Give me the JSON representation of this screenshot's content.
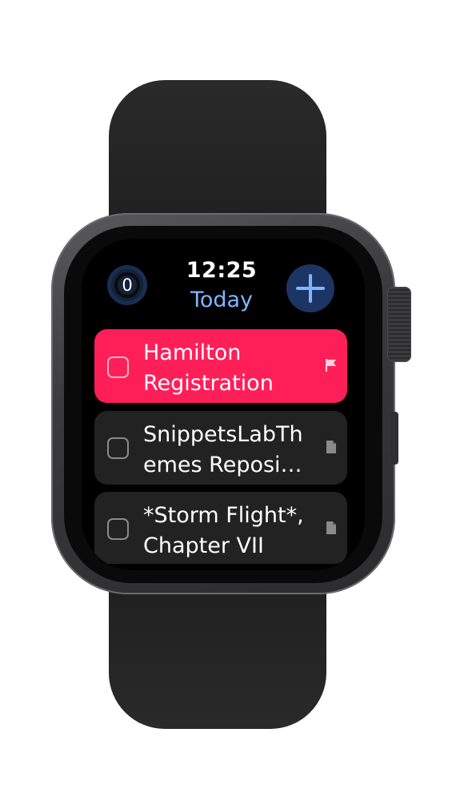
{
  "status": {
    "time": "12:25",
    "title": "Today"
  },
  "counter": {
    "value": "0"
  },
  "add": {
    "icon": "plus-icon"
  },
  "tasks": [
    {
      "title": "Hamilton\nRegistration",
      "flagged": true,
      "icon": "flag-icon",
      "color": "#fe1f59"
    },
    {
      "title": "SnippetsLabTh\nemes Reposi…",
      "flagged": false,
      "icon": "note-icon"
    },
    {
      "title": "*Storm Flight*,\nChapter VII",
      "flagged": false,
      "icon": "note-icon"
    }
  ],
  "colors": {
    "accent": "#7eb6ff",
    "add_button": "#1d3564",
    "flag_red": "#fe1f59",
    "row_background": "#222222"
  }
}
